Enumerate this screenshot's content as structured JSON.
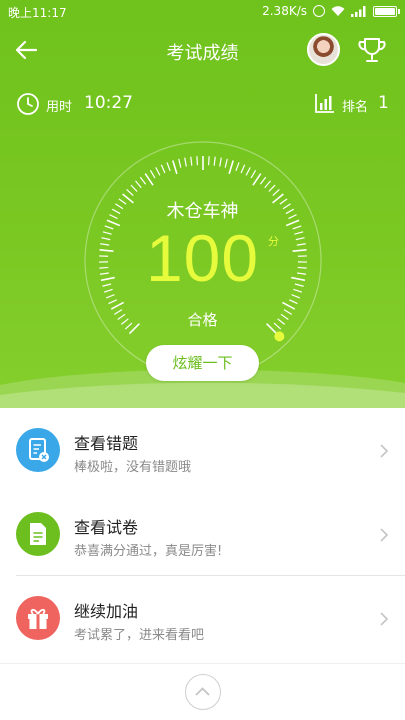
{
  "status_bar": {
    "time": "晚上11:17",
    "net_speed": "2.38K/s"
  },
  "header": {
    "title": "考试成绩"
  },
  "info": {
    "used_label": "用时",
    "used_value": "10:27",
    "rank_label": "排名",
    "rank_value": "1"
  },
  "gauge": {
    "name": "木仓车神",
    "score": "100",
    "unit": "分",
    "status": "合格",
    "fill_fraction": 1.0
  },
  "share_label": "炫耀一下",
  "list": [
    {
      "title": "查看错题",
      "subtitle": "棒极啦，没有错题哦",
      "icon": "wrong-questions-icon",
      "color": "#3aa8e8"
    },
    {
      "title": "查看试卷",
      "subtitle": "恭喜满分通过，真是厉害!",
      "icon": "paper-icon",
      "color": "#6cbf1f"
    },
    {
      "title": "继续加油",
      "subtitle": "考试累了，进来看看吧",
      "icon": "gift-icon",
      "color": "#f0645f"
    }
  ],
  "colors": {
    "header_green": "#76c520",
    "score_yellow": "#e6fb3c",
    "blue": "#3aa8e8",
    "green": "#6cbf1f",
    "red": "#f0645f"
  }
}
